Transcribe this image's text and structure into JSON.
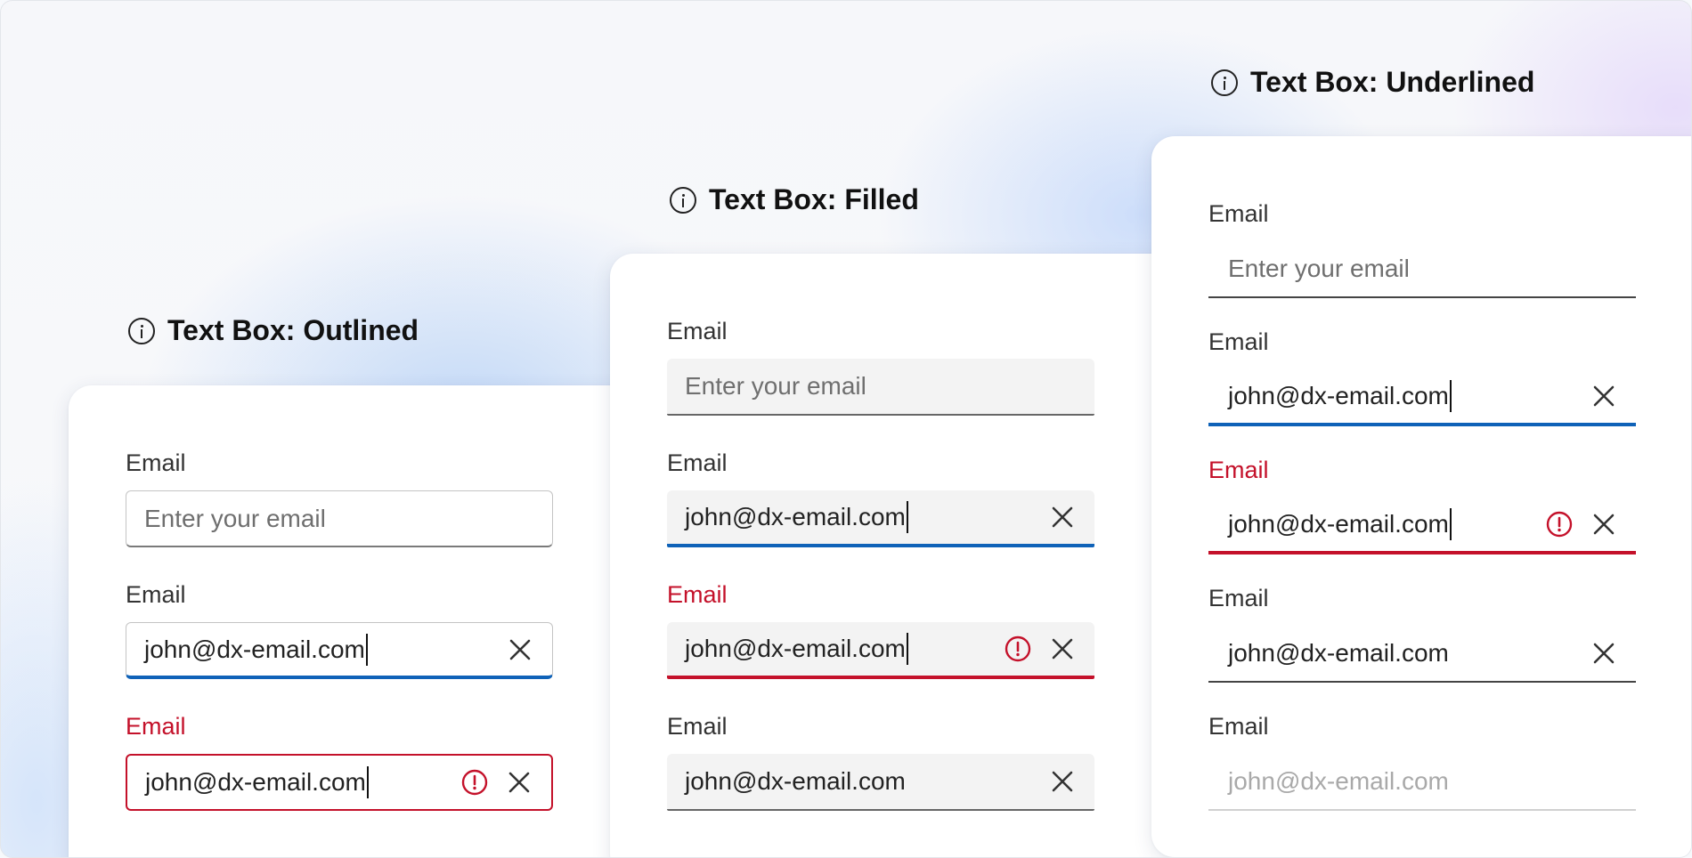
{
  "colors": {
    "focus": "#0f62b8",
    "error": "#c4112a",
    "text": "#222222"
  },
  "outlined": {
    "title": "Text Box: Outlined",
    "fields": [
      {
        "label": "Email",
        "placeholder": "Enter your email"
      },
      {
        "label": "Email",
        "value": "john@dx-email.com"
      },
      {
        "label": "Email",
        "value": "john@dx-email.com"
      }
    ]
  },
  "filled": {
    "title": "Text Box: Filled",
    "fields": [
      {
        "label": "Email",
        "placeholder": "Enter your email"
      },
      {
        "label": "Email",
        "value": "john@dx-email.com"
      },
      {
        "label": "Email",
        "value": "john@dx-email.com"
      },
      {
        "label": "Email",
        "value": "john@dx-email.com"
      }
    ]
  },
  "underlined": {
    "title": "Text Box: Underlined",
    "fields": [
      {
        "label": "Email",
        "placeholder": "Enter your email"
      },
      {
        "label": "Email",
        "value": "john@dx-email.com"
      },
      {
        "label": "Email",
        "value": "john@dx-email.com"
      },
      {
        "label": "Email",
        "value": "john@dx-email.com"
      },
      {
        "label": "Email",
        "value": "john@dx-email.com"
      }
    ]
  },
  "icons": {
    "info": "info-circle-icon",
    "clear": "dismiss-icon",
    "error": "error-circle-icon"
  }
}
